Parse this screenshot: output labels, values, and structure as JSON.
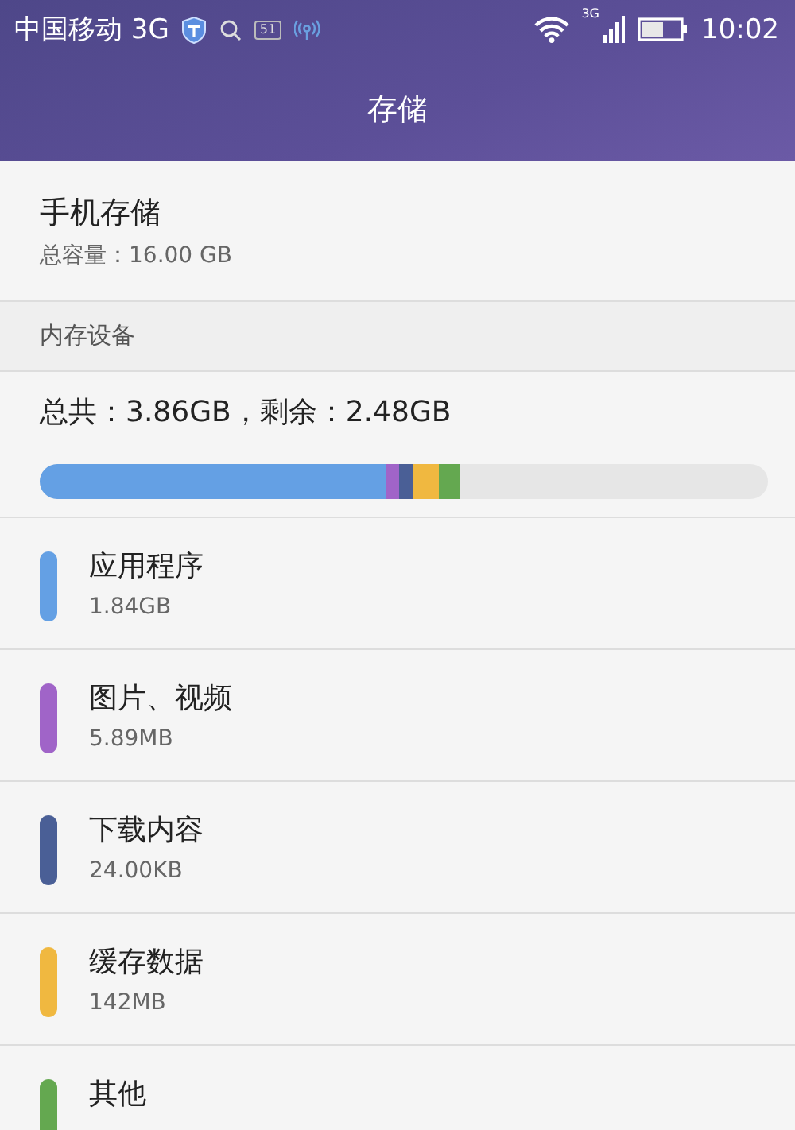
{
  "status_bar": {
    "carrier": "中国移动 3G",
    "notification_badge": "51",
    "network_label": "3G",
    "time": "10:02"
  },
  "title_bar": {
    "title": "存储"
  },
  "phone_storage": {
    "title": "手机存储",
    "capacity": "总容量：16.00 GB"
  },
  "section": {
    "title": "内存设备"
  },
  "summary": "总共：3.86GB，剩余：2.48GB",
  "categories": [
    {
      "name": "应用程序",
      "size": "1.84GB",
      "color": "#64a0e4"
    },
    {
      "name": "图片、视频",
      "size": "5.89MB",
      "color": "#a064c8"
    },
    {
      "name": "下载内容",
      "size": "24.00KB",
      "color": "#4a5f96"
    },
    {
      "name": "缓存数据",
      "size": "142MB",
      "color": "#f0b840"
    },
    {
      "name": "其他",
      "color": "#64a850"
    }
  ]
}
